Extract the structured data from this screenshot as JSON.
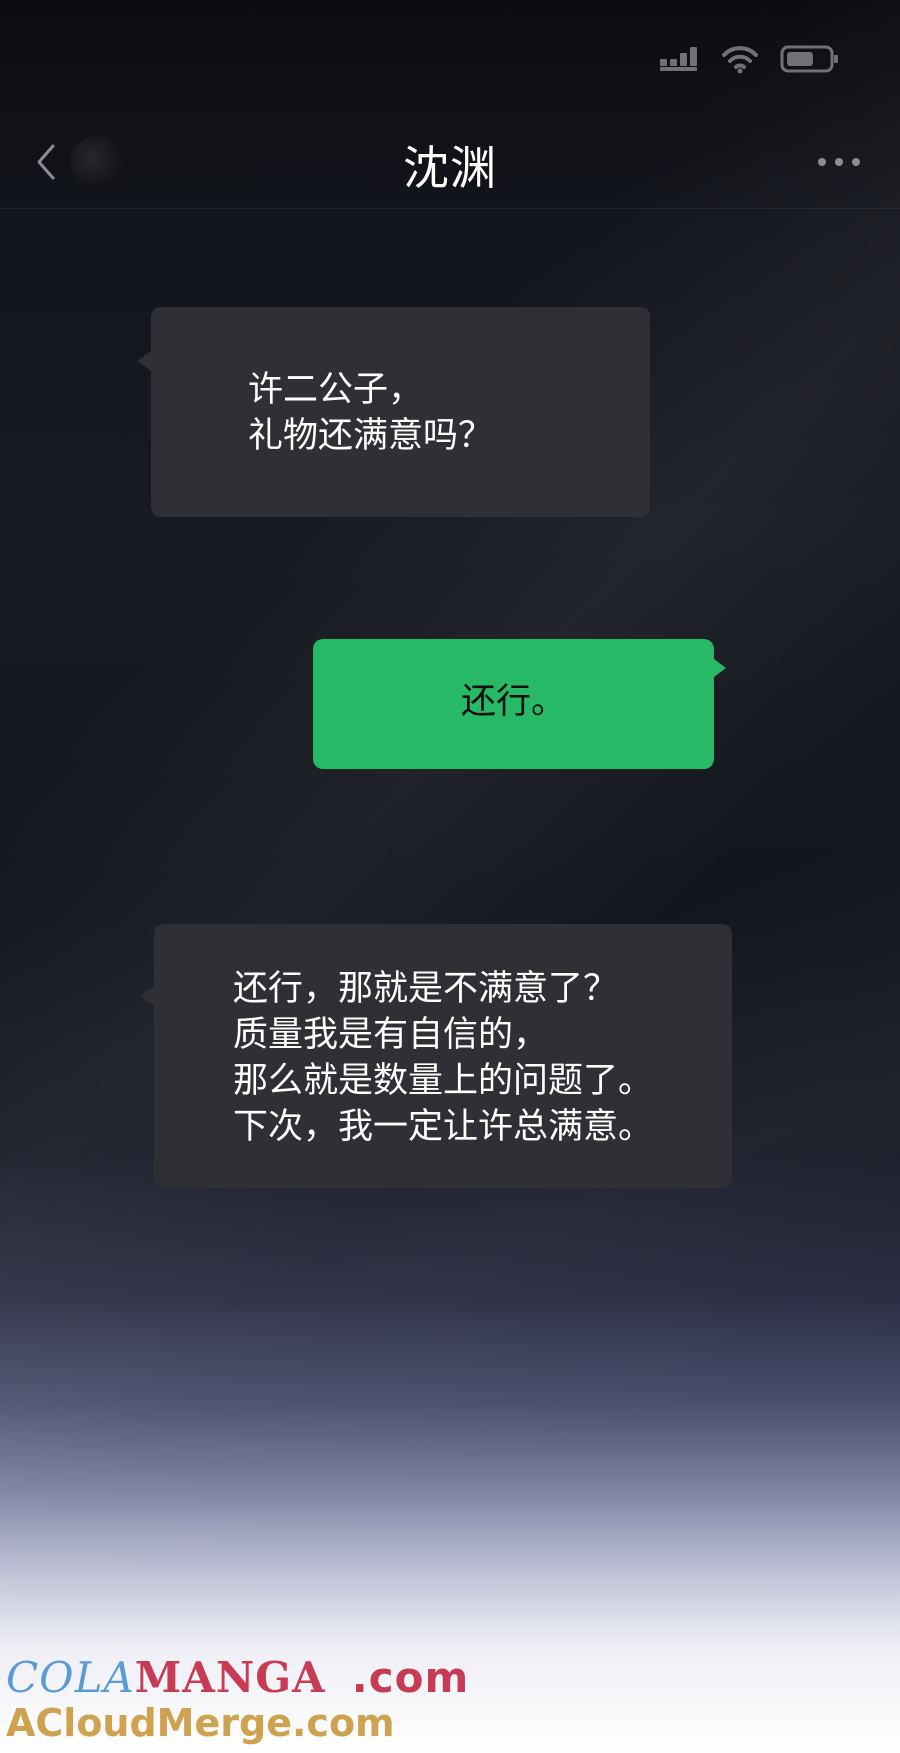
{
  "status_bar": {
    "icons": [
      "signal-icon",
      "wifi-icon",
      "battery-icon"
    ]
  },
  "header": {
    "title": "沈渊",
    "back_icon": "chevron-left-icon",
    "more_icon": "more-dots-icon"
  },
  "messages": [
    {
      "direction": "incoming",
      "text": "许二公子，\n礼物还满意吗？"
    },
    {
      "direction": "outgoing",
      "text": "还行。"
    },
    {
      "direction": "incoming",
      "text": "还行，那就是不满意了？\n质量我是有自信的，\n那么就是数量上的问题了。\n下次，我一定让许总满意。"
    }
  ],
  "colors": {
    "incoming_bubble": "#2f3035",
    "outgoing_bubble": "#27b966"
  },
  "watermark": {
    "cola": "COLA",
    "manga": "MANGA",
    "com1": ".com",
    "line2": "ACloudMerge.com"
  }
}
